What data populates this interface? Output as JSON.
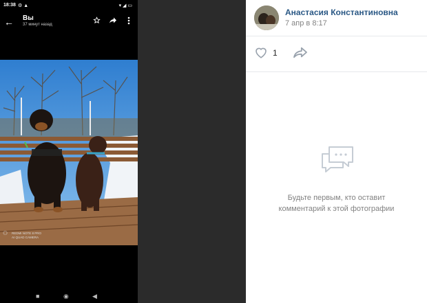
{
  "phone": {
    "status_bar": {
      "time": "18:38",
      "extra": "⚙ ▲",
      "right": "▾ ◢ ▭"
    },
    "app_bar": {
      "back": "←",
      "title": "Вы",
      "subtitle": "37 минут назад"
    },
    "photo": {
      "watermark_line1": "REDMI NOTE 8 PRO",
      "watermark_line2": "AI QUAD CAMERA"
    },
    "nav": {
      "square": "■",
      "circle": "◉",
      "back": "◀"
    }
  },
  "post": {
    "author": "Анастасия Константиновна",
    "date": "7 апр в 8:17",
    "likes": "1",
    "empty_line1": "Будьте первым, кто оставит",
    "empty_line2": "комментарий к этой фотографии"
  },
  "icons": {
    "back": "arrow-left-icon",
    "star": "star-icon",
    "share": "share-icon",
    "more": "more-vert-icon",
    "like": "heart-icon",
    "repost": "share-arrow-icon",
    "comments": "comments-icon"
  },
  "colors": {
    "link": "#2a5885",
    "muted": "#828282",
    "icon": "#99a2ad",
    "divider": "#e7e8ec",
    "sky": "#3a87cf",
    "backdrop": "#2b2b2b"
  }
}
